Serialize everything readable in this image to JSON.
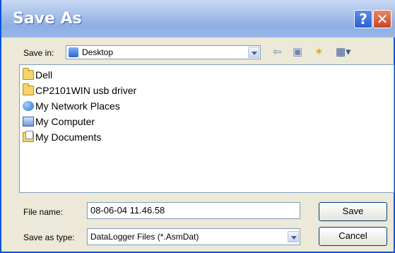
{
  "dialog": {
    "title": "Save As",
    "help_glyph": "?",
    "close_glyph": "✕"
  },
  "toolbar": {
    "save_in_label": "Save in:",
    "location": "Desktop",
    "icons": [
      "back-arrow-icon",
      "up-folder-icon",
      "new-folder-icon",
      "view-menu-icon"
    ]
  },
  "files": [
    {
      "name": "Dell",
      "icon": "folder-icon"
    },
    {
      "name": "CP2101WIN usb driver",
      "icon": "folder-icon"
    },
    {
      "name": "My Network Places",
      "icon": "network-places-icon"
    },
    {
      "name": "My Computer",
      "icon": "computer-icon"
    },
    {
      "name": "My Documents",
      "icon": "documents-folder-icon"
    }
  ],
  "form": {
    "file_name_label": "File name:",
    "file_name_value": "08-06-04 11.46.58",
    "save_type_label": "Save as type:",
    "save_type_value": "DataLogger Files (*.AsmDat)",
    "save_button": "Save",
    "cancel_button": "Cancel"
  }
}
